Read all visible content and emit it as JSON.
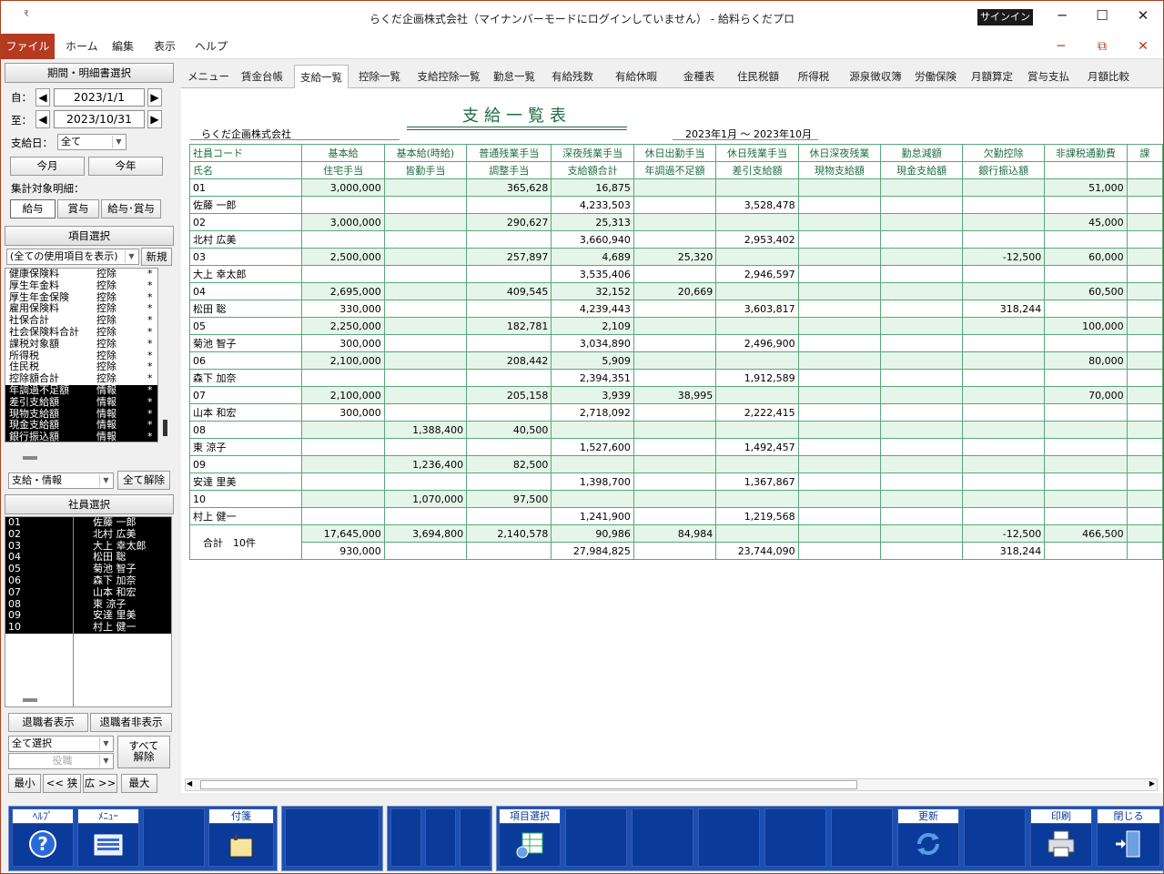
{
  "window": {
    "title": "らくだ企画株式会社（マイナンバーモードにログインしていません） - 給料らくだプロ",
    "sys_icon": "₹",
    "signin": "サインイン",
    "min": "─",
    "max": "☐",
    "close": "✕"
  },
  "menu": {
    "items": [
      "ファイル",
      "ホーム",
      "編集",
      "表示",
      "ヘルプ"
    ],
    "min": "─",
    "restore": "⧉",
    "close": "✕"
  },
  "left": {
    "period_header": "期間・明細書選択",
    "from_label": "自：",
    "from_value": "2023/1/1",
    "to_label": "至：",
    "to_value": "2023/10/31",
    "payday_label": "支給日：",
    "payday_value": "全て",
    "this_month": "今月",
    "this_year": "今年",
    "agg_label": "集計対象明細：",
    "agg_buttons": [
      "給与",
      "賞与",
      "給与･賞与"
    ],
    "item_header": "項目選択",
    "item_filter": "(全ての使用項目を表示)",
    "new_btn": "新規",
    "items": [
      {
        "name": "健康保険料",
        "type": "控除",
        "mark": "*",
        "sel": false
      },
      {
        "name": "厚生年金料",
        "type": "控除",
        "mark": "*",
        "sel": false
      },
      {
        "name": "厚生年金保険",
        "type": "控除",
        "mark": "*",
        "sel": false
      },
      {
        "name": "雇用保険料",
        "type": "控除",
        "mark": "*",
        "sel": false
      },
      {
        "name": "社保合計",
        "type": "控除",
        "mark": "*",
        "sel": false
      },
      {
        "name": "社会保険料合計",
        "type": "控除",
        "mark": "*",
        "sel": false
      },
      {
        "name": "課税対象額",
        "type": "控除",
        "mark": "*",
        "sel": false
      },
      {
        "name": "所得税",
        "type": "控除",
        "mark": "*",
        "sel": false
      },
      {
        "name": "住民税",
        "type": "控除",
        "mark": "*",
        "sel": false
      },
      {
        "name": "控除額合計",
        "type": "控除",
        "mark": "*",
        "sel": false
      },
      {
        "name": "年調過不足額",
        "type": "情報",
        "mark": "*",
        "sel": true
      },
      {
        "name": "差引支給額",
        "type": "情報",
        "mark": "*",
        "sel": true
      },
      {
        "name": "現物支給額",
        "type": "情報",
        "mark": "*",
        "sel": true
      },
      {
        "name": "現金支給額",
        "type": "情報",
        "mark": "*",
        "sel": true
      },
      {
        "name": "銀行振込額",
        "type": "情報",
        "mark": "*",
        "sel": true
      }
    ],
    "item_type_select": "支給・情報",
    "clear_all": "全て解除",
    "emp_header": "社員選択",
    "employees": [
      {
        "code": "01",
        "name": "佐藤 一郎"
      },
      {
        "code": "02",
        "name": "北村 広美"
      },
      {
        "code": "03",
        "name": "大上 幸太郎"
      },
      {
        "code": "04",
        "name": "松田 聡"
      },
      {
        "code": "05",
        "name": "菊池 智子"
      },
      {
        "code": "06",
        "name": "森下 加奈"
      },
      {
        "code": "07",
        "name": "山本 和宏"
      },
      {
        "code": "08",
        "name": "東 涼子"
      },
      {
        "code": "09",
        "name": "安達 里美"
      },
      {
        "code": "10",
        "name": "村上 健一"
      }
    ],
    "show_retired": "退職者表示",
    "hide_retired": "退職者非表示",
    "select_all": "全て選択",
    "post": "役職",
    "release_all_1": "すべて",
    "release_all_2": "解除",
    "zoom": [
      "最小",
      "<< 狭",
      "広 >>",
      "最大"
    ]
  },
  "tabs": [
    "メニュー",
    "賃金台帳",
    "支給一覧",
    "控除一覧",
    "支給控除一覧",
    "勤怠一覧",
    "有給残数",
    "有給休暇",
    "金種表",
    "住民税額",
    "所得税",
    "源泉徴収簿",
    "労働保険",
    "月額算定",
    "賞与支払",
    "月額比較"
  ],
  "active_tab": 2,
  "report": {
    "title": "支給一覧表",
    "company": "らくだ企画株式会社",
    "period": "2023年1月 〜 2023年10月",
    "head1": [
      "社員コード",
      "基本給",
      "基本給(時給)",
      "普通残業手当",
      "深夜残業手当",
      "休日出勤手当",
      "休日残業手当",
      "休日深夜残業",
      "勤怠減額",
      "欠勤控除",
      "非課税通勤費",
      "課"
    ],
    "head2": [
      "氏名",
      "住宅手当",
      "皆勤手当",
      "調整手当",
      "支給額合計",
      "年調過不足額",
      "差引支給額",
      "現物支給額",
      "現金支給額",
      "銀行振込額",
      "",
      ""
    ],
    "rows": [
      {
        "code": "01",
        "name": "佐藤 一郎",
        "r1": [
          "3,000,000",
          "",
          "365,628",
          "16,875",
          "",
          "",
          "",
          "",
          "",
          "51,000",
          ""
        ],
        "r2": [
          "",
          "",
          "",
          "4,233,503",
          "",
          "3,528,478",
          "",
          "",
          "",
          "",
          ""
        ]
      },
      {
        "code": "02",
        "name": "北村 広美",
        "r1": [
          "3,000,000",
          "",
          "290,627",
          "25,313",
          "",
          "",
          "",
          "",
          "",
          "45,000",
          ""
        ],
        "r2": [
          "",
          "",
          "",
          "3,660,940",
          "",
          "2,953,402",
          "",
          "",
          "",
          "",
          ""
        ]
      },
      {
        "code": "03",
        "name": "大上 幸太郎",
        "r1": [
          "2,500,000",
          "",
          "257,897",
          "4,689",
          "25,320",
          "",
          "",
          "",
          "-12,500",
          "60,000",
          ""
        ],
        "r2": [
          "",
          "",
          "",
          "3,535,406",
          "",
          "2,946,597",
          "",
          "",
          "",
          "",
          ""
        ]
      },
      {
        "code": "04",
        "name": "松田 聡",
        "r1": [
          "2,695,000",
          "",
          "409,545",
          "32,152",
          "20,669",
          "",
          "",
          "",
          "",
          "60,500",
          ""
        ],
        "r2": [
          "330,000",
          "",
          "",
          "4,239,443",
          "",
          "3,603,817",
          "",
          "",
          "318,244",
          "",
          ""
        ]
      },
      {
        "code": "05",
        "name": "菊池 智子",
        "r1": [
          "2,250,000",
          "",
          "182,781",
          "2,109",
          "",
          "",
          "",
          "",
          "",
          "100,000",
          ""
        ],
        "r2": [
          "300,000",
          "",
          "",
          "3,034,890",
          "",
          "2,496,900",
          "",
          "",
          "",
          "",
          ""
        ]
      },
      {
        "code": "06",
        "name": "森下 加奈",
        "r1": [
          "2,100,000",
          "",
          "208,442",
          "5,909",
          "",
          "",
          "",
          "",
          "",
          "80,000",
          ""
        ],
        "r2": [
          "",
          "",
          "",
          "2,394,351",
          "",
          "1,912,589",
          "",
          "",
          "",
          "",
          ""
        ]
      },
      {
        "code": "07",
        "name": "山本 和宏",
        "r1": [
          "2,100,000",
          "",
          "205,158",
          "3,939",
          "38,995",
          "",
          "",
          "",
          "",
          "70,000",
          ""
        ],
        "r2": [
          "300,000",
          "",
          "",
          "2,718,092",
          "",
          "2,222,415",
          "",
          "",
          "",
          "",
          ""
        ]
      },
      {
        "code": "08",
        "name": "東 涼子",
        "r1": [
          "",
          "1,388,400",
          "40,500",
          "",
          "",
          "",
          "",
          "",
          "",
          "",
          ""
        ],
        "r2": [
          "",
          "",
          "",
          "1,527,600",
          "",
          "1,492,457",
          "",
          "",
          "",
          "",
          ""
        ]
      },
      {
        "code": "09",
        "name": "安達 里美",
        "r1": [
          "",
          "1,236,400",
          "82,500",
          "",
          "",
          "",
          "",
          "",
          "",
          "",
          ""
        ],
        "r2": [
          "",
          "",
          "",
          "1,398,700",
          "",
          "1,367,867",
          "",
          "",
          "",
          "",
          ""
        ]
      },
      {
        "code": "10",
        "name": "村上 健一",
        "r1": [
          "",
          "1,070,000",
          "97,500",
          "",
          "",
          "",
          "",
          "",
          "",
          "",
          ""
        ],
        "r2": [
          "",
          "",
          "",
          "1,241,900",
          "",
          "1,219,568",
          "",
          "",
          "",
          "",
          ""
        ]
      }
    ],
    "total": {
      "label": "合計　10件",
      "r1": [
        "17,645,000",
        "3,694,800",
        "2,140,578",
        "90,986",
        "84,984",
        "",
        "",
        "",
        "-12,500",
        "466,500",
        ""
      ],
      "r2": [
        "930,000",
        "",
        "",
        "27,984,825",
        "",
        "23,744,090",
        "",
        "",
        "318,244",
        "",
        ""
      ]
    }
  },
  "footer": {
    "help": "ﾍﾙﾌﾟ",
    "menu": "ﾒﾆｭｰ",
    "sticky": "付箋",
    "item_select": "項目選択",
    "update": "更新",
    "print": "印刷",
    "close": "閉じる"
  }
}
